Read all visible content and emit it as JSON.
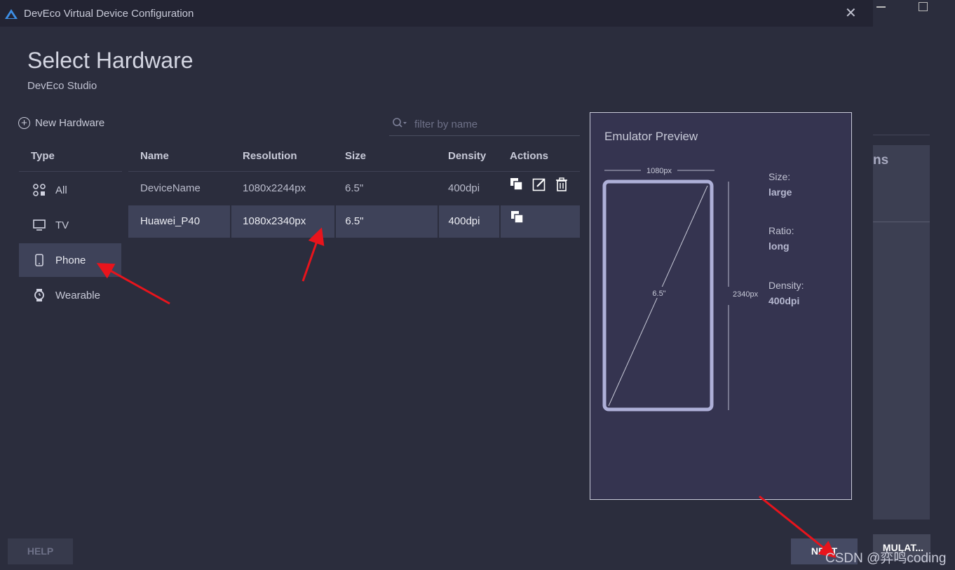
{
  "window": {
    "title": "DevEco Virtual Device Configuration",
    "close_glyph": "✕"
  },
  "page": {
    "heading": "Select Hardware",
    "subheading": "DevEco Studio"
  },
  "toolbar": {
    "new_hardware_label": "New Hardware",
    "filter_placeholder": "filter by name"
  },
  "types": {
    "header": "Type",
    "items": [
      {
        "label": "All",
        "icon": "grid-icon"
      },
      {
        "label": "TV",
        "icon": "tv-icon"
      },
      {
        "label": "Phone",
        "icon": "phone-icon",
        "selected": true
      },
      {
        "label": "Wearable",
        "icon": "watch-icon"
      }
    ]
  },
  "table": {
    "columns": [
      "Name",
      "Resolution",
      "Size",
      "Density",
      "Actions"
    ],
    "rows": [
      {
        "name": "DeviceName",
        "resolution": "1080x2244px",
        "size": "6.5\"",
        "density": "400dpi",
        "actions": [
          "copy-icon",
          "edit-icon",
          "delete-icon"
        ]
      },
      {
        "name": "Huawei_P40",
        "resolution": "1080x2340px",
        "size": "6.5\"",
        "density": "400dpi",
        "actions": [
          "copy-icon"
        ],
        "selected": true
      }
    ]
  },
  "preview": {
    "title": "Emulator Preview",
    "width_label": "1080px",
    "height_label": "2340px",
    "diagonal_label": "6.5\"",
    "specs": [
      {
        "label": "Size:",
        "value": "large"
      },
      {
        "label": "Ratio:",
        "value": "long"
      },
      {
        "label": "Density:",
        "value": "400dpi"
      }
    ]
  },
  "buttons": {
    "help": "HELP",
    "next": "NEXT"
  },
  "background_window": {
    "partial_heading": "ns",
    "partial_button": "MULAT..."
  },
  "watermark": "CSDN @弈鸣coding",
  "colors": {
    "background": "#2b2d3d",
    "titlebar": "#232433",
    "selection": "#3e4259",
    "preview_bg": "#353450",
    "device_frame": "#aeb0d8",
    "annotation_arrow": "#e8141c"
  }
}
